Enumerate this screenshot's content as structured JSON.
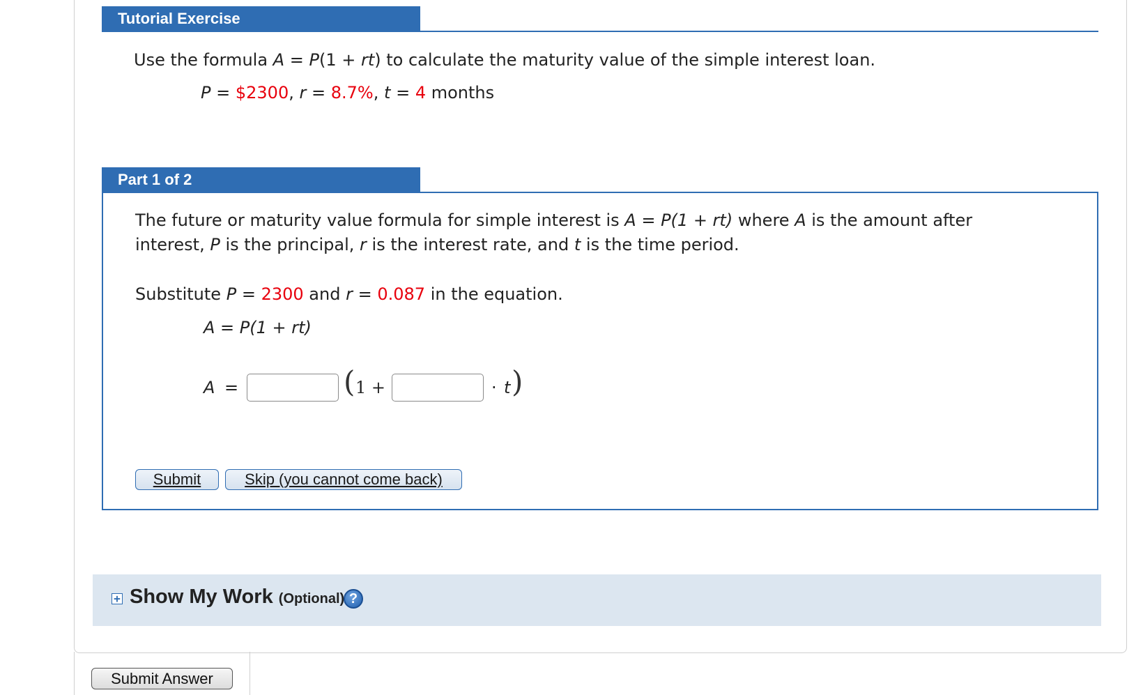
{
  "tutorial": {
    "header": "Tutorial Exercise",
    "intro": {
      "pre": "Use the formula",
      "formula_A": "A",
      "formula_eq": " = ",
      "formula_P": "P",
      "formula_paren1": "(1 + ",
      "formula_rt": "rt",
      "formula_paren2": ")",
      "post": "to calculate the maturity value of the simple interest loan."
    },
    "given": {
      "P_label": "P",
      "eq": " = ",
      "P_value": "$2300",
      "sep1": ",",
      "r_label": "r",
      "r_value": "8.7%",
      "sep2": ",",
      "t_label": "t",
      "t_value": "4",
      "t_unit": "months"
    }
  },
  "part": {
    "header": "Part 1 of 2",
    "description_line1_pre": "The future or maturity value formula for simple interest is",
    "description_line1_formula": "A = P(1 + rt)",
    "description_line1_where": "where",
    "description_line1_A": "A",
    "description_line1_post": "is the amount after",
    "description_line2_pre": "interest,",
    "description_line2_P": "P",
    "description_line2_mid1": "is the principal,",
    "description_line2_r": "r",
    "description_line2_mid2": "is the interest rate, and",
    "description_line2_t": "t",
    "description_line2_post": "is the time period.",
    "substitute_pre": "Substitute",
    "substitute_P": "P",
    "substitute_eq": " = ",
    "substitute_P_value": "2300",
    "substitute_and": "and",
    "substitute_r": "r",
    "substitute_r_value": "0.087",
    "substitute_post": "in the equation.",
    "equation_line": "A  =  P(1 + rt)",
    "answer_A": "A",
    "answer_eq": "=",
    "answer_one_plus": "1 +",
    "answer_dot": "·",
    "answer_t": "t",
    "input1_value": "",
    "input2_value": "",
    "submit_label": "Submit",
    "skip_label": "Skip (you cannot come back)"
  },
  "show_my_work": {
    "title": "Show My Work",
    "optional": "(Optional)",
    "help_glyph": "?",
    "expand_glyph": "+"
  },
  "footer": {
    "submit_answer_label": "Submit Answer"
  },
  "colors": {
    "header_blue": "#2f6db3",
    "highlight_red": "#e8000d",
    "show_work_bg": "#dce6f0"
  }
}
